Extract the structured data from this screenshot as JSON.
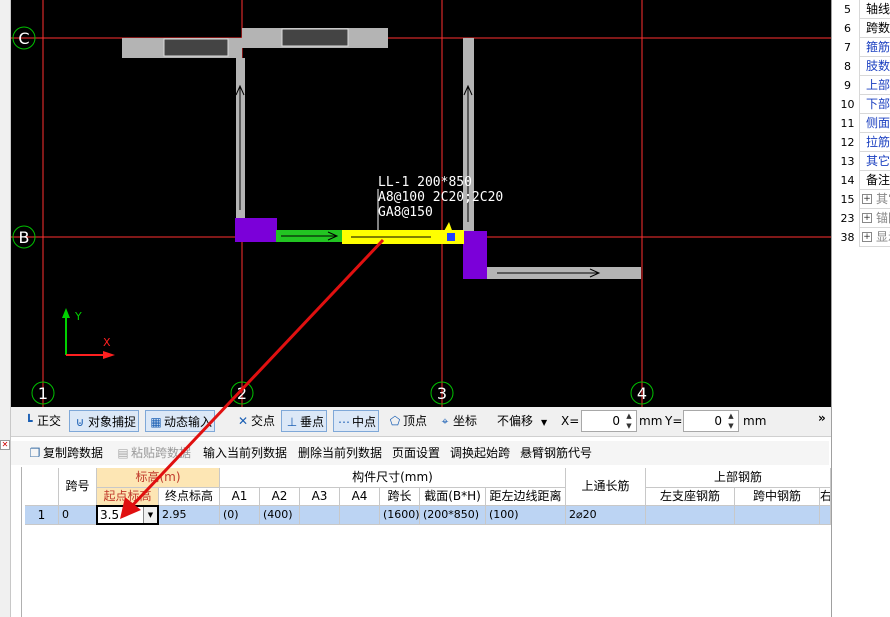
{
  "canvas": {
    "axis_labels_x": [
      "1",
      "2",
      "3",
      "4"
    ],
    "axis_labels_y": [
      "C",
      "B"
    ],
    "beam_annotation": [
      "LL-1 200*850",
      "A8@100 2C20;2C20",
      "GA8@150"
    ],
    "ucs_x": "X",
    "ucs_y": "Y",
    "colors": {
      "background": "#000000",
      "gridline": "#ff3030",
      "beam_gray": "#b4b4b4",
      "beam_yellow": "#ffff00",
      "beam_green": "#22c422",
      "support_purple": "#7b00d9",
      "pointer_arrow": "#e01010",
      "ucs_green": "#00d000"
    }
  },
  "property_panel": {
    "rows": [
      {
        "num": "5",
        "name": "轴线",
        "type": "plain"
      },
      {
        "num": "6",
        "name": "跨数",
        "type": "plain"
      },
      {
        "num": "7",
        "name": "箍筋",
        "type": "blue"
      },
      {
        "num": "8",
        "name": "肢数",
        "type": "blue"
      },
      {
        "num": "9",
        "name": "上部",
        "type": "blue"
      },
      {
        "num": "10",
        "name": "下部",
        "type": "blue"
      },
      {
        "num": "11",
        "name": "侧面",
        "type": "blue"
      },
      {
        "num": "12",
        "name": "拉筋",
        "type": "blue"
      },
      {
        "num": "13",
        "name": "其它",
        "type": "blue"
      },
      {
        "num": "14",
        "name": "备注",
        "type": "plain"
      },
      {
        "num": "15",
        "name": "其它",
        "type": "group"
      },
      {
        "num": "23",
        "name": "锚固",
        "type": "group"
      },
      {
        "num": "38",
        "name": "显示",
        "type": "group"
      }
    ]
  },
  "snap_toolbar": {
    "ortho": "正交",
    "object_snap": "对象捕捉",
    "dynamic_input": "动态输入",
    "intersection": "交点",
    "perpendicular": "垂点",
    "midpoint": "中点",
    "vertex": "顶点",
    "coordinate": "坐标",
    "offset_select": "不偏移",
    "x_label": "X=",
    "x_value": "0",
    "y_label": "Y=",
    "y_value": "0",
    "unit_mm": "mm",
    "more": "»"
  },
  "edit_toolbar": {
    "copy_span": "复制跨数据",
    "paste_span": "粘贴跨数据",
    "input_column": "输入当前列数据",
    "delete_column": "删除当前列数据",
    "page_setup": "页面设置",
    "swap_start": "调换起始跨",
    "cantilever": "悬臂钢筋代号"
  },
  "table": {
    "headers": {
      "span_no": "跨号",
      "elevation_group": "标高(m)",
      "start_elev": "起点标高",
      "end_elev": "终点标高",
      "dim_group": "构件尺寸(mm)",
      "a1": "A1",
      "a2": "A2",
      "a3": "A3",
      "a4": "A4",
      "span_len": "跨长",
      "section": "截面(B*H)",
      "edge_dist": "距左边线距离",
      "top_through": "上通长筋",
      "top_group": "上部钢筋",
      "left_support": "左支座钢筋",
      "mid_span": "跨中钢筋",
      "right_cut": "右"
    },
    "rows": [
      {
        "row": "1",
        "span_no": "0",
        "start_elev": "3.5",
        "end_elev": "2.95",
        "a1": "(0)",
        "a2": "(400)",
        "a3": "",
        "a4": "",
        "span_len": "(1600)",
        "section": "(200*850)",
        "edge_dist": "(100)",
        "top_through": "2⌀20",
        "left_support": "",
        "mid_span": ""
      }
    ]
  }
}
